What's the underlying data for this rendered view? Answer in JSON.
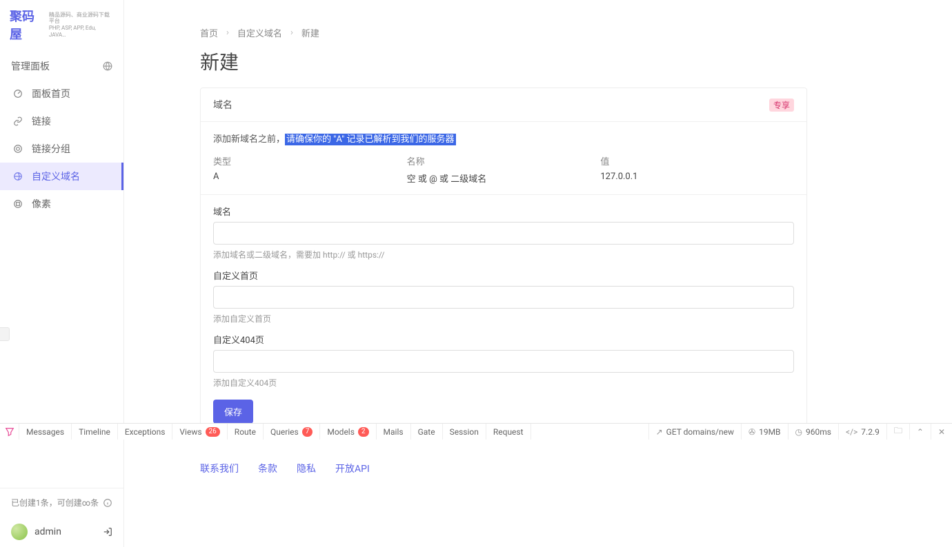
{
  "brand": {
    "name": "聚码屋",
    "tagline": "精品源码、商业源码下载平台\nPHP, ASP, APP, Edu, JAVA…"
  },
  "sidebar": {
    "panel_title": "管理面板",
    "items": [
      {
        "label": "面板首页"
      },
      {
        "label": "链接"
      },
      {
        "label": "链接分组"
      },
      {
        "label": "自定义域名"
      },
      {
        "label": "像素"
      }
    ],
    "footer_status": "已创建1条，可创建∞条",
    "user": "admin"
  },
  "breadcrumb": {
    "home": "首页",
    "section": "自定义域名",
    "current": "新建"
  },
  "page_title": "新建",
  "card": {
    "header": "域名",
    "badge": "专享",
    "notice_prefix": "添加新域名之前，",
    "notice_highlight": "请确保你的 \"A\" 记录已解析到我们的服务器",
    "columns": {
      "type_h": "类型",
      "type_v": "A",
      "name_h": "名称",
      "name_v": "空 或 @ 或 二级域名",
      "value_h": "值",
      "value_v": "127.0.0.1"
    },
    "form": {
      "domain": {
        "label": "域名",
        "help": "添加域名或二级域名，需要加 http:// 或 https://"
      },
      "index": {
        "label": "自定义首页",
        "help": "添加自定义首页"
      },
      "notfound": {
        "label": "自定义404页",
        "help": "添加自定义404页"
      },
      "submit": "保存"
    }
  },
  "footer": {
    "contact": "联系我们",
    "terms": "条款",
    "privacy": "隐私",
    "api": "开放API"
  },
  "debugbar": {
    "tabs": {
      "messages": "Messages",
      "timeline": "Timeline",
      "exceptions": "Exceptions",
      "views": "Views",
      "views_n": "26",
      "route": "Route",
      "queries": "Queries",
      "queries_n": "7",
      "models": "Models",
      "models_n": "2",
      "mails": "Mails",
      "gate": "Gate",
      "session": "Session",
      "request": "Request"
    },
    "right": {
      "route": "GET domains/new",
      "mem": "19MB",
      "time": "960ms",
      "php": "7.2.9"
    }
  }
}
